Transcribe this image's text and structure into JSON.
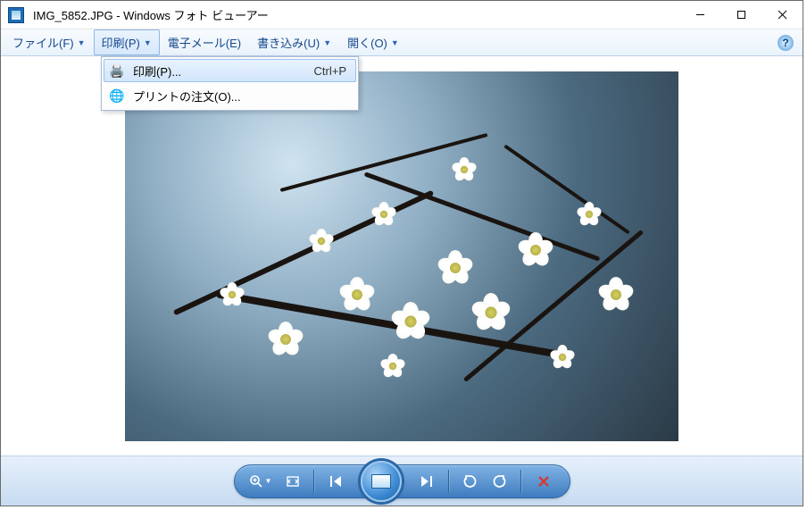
{
  "title": "IMG_5852.JPG - Windows フォト ビューアー",
  "menu": {
    "file": "ファイル(F)",
    "print": "印刷(P)",
    "email": "電子メール(E)",
    "write": "書き込み(U)",
    "open": "開く(O)"
  },
  "dropdown": {
    "print": {
      "label": "印刷(P)...",
      "shortcut": "Ctrl+P"
    },
    "order": {
      "label": "プリントの注文(O)..."
    }
  },
  "toolbar": {
    "zoom": "zoom",
    "fit": "fit",
    "prev": "previous",
    "play": "slideshow",
    "next": "next",
    "ccw": "rotate-ccw",
    "cw": "rotate-cw",
    "del": "delete"
  },
  "image": {
    "alt": "White plum blossoms on dark branches against blurred blue sky"
  }
}
